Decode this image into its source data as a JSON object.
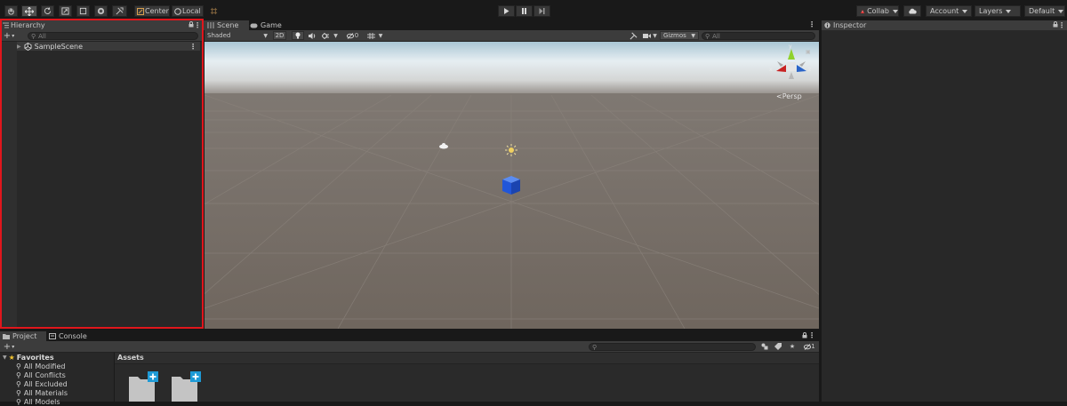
{
  "toolbar": {
    "tools": [
      "hand-tool",
      "move-tool",
      "rotate-tool",
      "scale-tool",
      "rect-tool",
      "transform-tool",
      "custom-tool"
    ],
    "pivot_label": "Center",
    "space_label": "Local",
    "collab_label": "Collab",
    "account_label": "Account",
    "layers_label": "Layers",
    "layout_label": "Default"
  },
  "hierarchy": {
    "tab_label": "Hierarchy",
    "add_label": "+",
    "search_placeholder": "All",
    "scene_label": "SampleScene"
  },
  "scene_view": {
    "tabs": [
      "Scene",
      "Game"
    ],
    "shading_mode": "Shaded",
    "mode_2d": "2D",
    "fx_count": "0",
    "gizmos_label": "Gizmos",
    "search_placeholder": "All",
    "gizmo_axes": {
      "x": "x",
      "y": "y",
      "z": "z"
    },
    "persp_label": "Persp",
    "colors": {
      "sky": "#e6eef2",
      "ground": "#756c64",
      "cube": "#2156d8",
      "gizmo_x": "#c82222",
      "gizmo_y": "#8fd12b",
      "gizmo_z": "#2a64c8"
    }
  },
  "inspector": {
    "tab_label": "Inspector"
  },
  "project": {
    "tabs": [
      "Project",
      "Console"
    ],
    "add_label": "+",
    "hidden_packages_count": "1",
    "favorites_label": "Favorites",
    "favorites": [
      "All Modified",
      "All Conflicts",
      "All Excluded",
      "All Materials",
      "All Models"
    ],
    "assets_label": "Assets",
    "asset_icons": [
      "folder-icon",
      "folder-icon"
    ]
  },
  "highlight": {
    "color": "#e0161c",
    "target": "hierarchy-panel"
  }
}
